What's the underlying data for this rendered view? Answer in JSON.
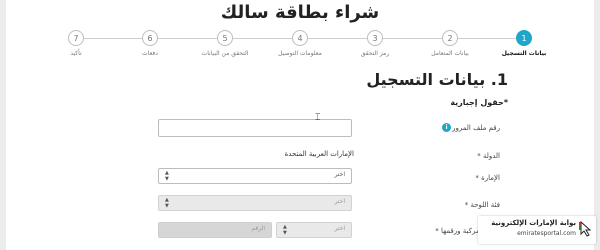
{
  "page_title": "شراء بطاقة سالك",
  "steps": [
    {
      "number": "1",
      "label": "بيانات التسجيل",
      "active": true
    },
    {
      "number": "2",
      "label": "بيانات المتعامل",
      "active": false
    },
    {
      "number": "3",
      "label": "رمز التحقق",
      "active": false
    },
    {
      "number": "4",
      "label": "معلومات التوصيل",
      "active": false
    },
    {
      "number": "5",
      "label": "التحقق من البيانات",
      "active": false
    },
    {
      "number": "6",
      "label": "دفعات",
      "active": false
    },
    {
      "number": "7",
      "label": "تأكيد",
      "active": false
    }
  ],
  "section_title": "1. بيانات التسجيل",
  "required_note": "*حقول إجبارية",
  "form": {
    "traffic_file_label": "رقم ملف المرور *",
    "traffic_file_value": "",
    "country_label": "الدولة *",
    "country_value": "الإمارات العربية المتحدة",
    "emirate_label": "الإمارة *",
    "emirate_value": "اختر",
    "plate_category_label": "فئة اللوحة *",
    "plate_category_value": "اختر",
    "plate_code_label": "لوحة المركبة ورقمها *",
    "plate_code_value": "اختر",
    "plate_number_placeholder": "الرقم"
  },
  "watermark": {
    "name": "بوابة الإمارات الإلكترونية",
    "url": "emiratesportal.com"
  },
  "colors": {
    "accent": "#1ea7c9"
  }
}
